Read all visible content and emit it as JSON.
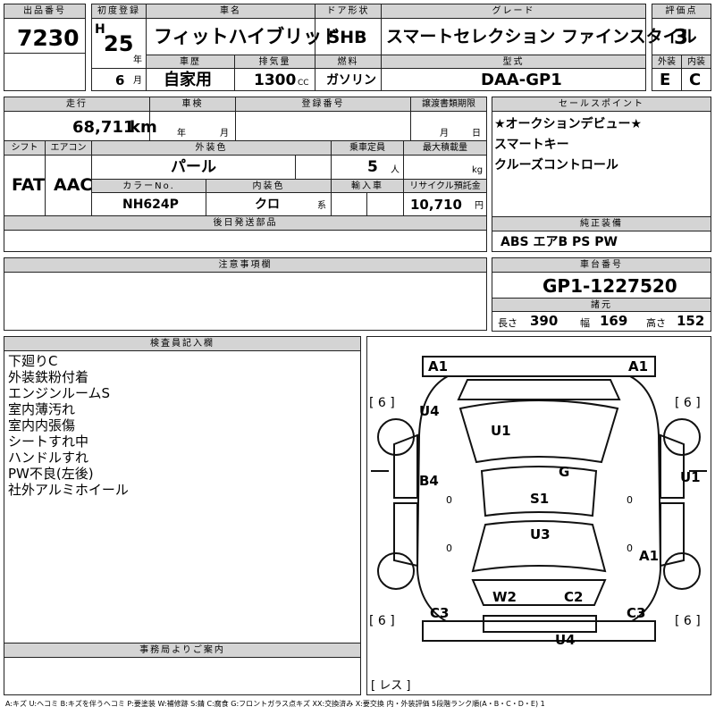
{
  "headers": {
    "lot_no": "出品番号",
    "first_reg": "初度登録",
    "car_name": "車名",
    "door": "ドア形状",
    "grade": "グレード",
    "rating": "評価点",
    "history": "車歴",
    "displacement": "排気量",
    "fuel": "燃料",
    "model_code": "型式",
    "exterior": "外装",
    "interior": "内装",
    "mileage": "走行",
    "inspection": "車検",
    "reg_no": "登録番号",
    "transfer_deadline": "譲渡書類期限",
    "sales_points": "セールスポイント",
    "shift": "シフト",
    "aircon": "エアコン",
    "ext_color": "外装色",
    "capacity": "乗車定員",
    "max_load": "最大積載量",
    "color_no": "カラーNo.",
    "int_color": "内装色",
    "import": "輸入車",
    "recycle": "リサイクル預託金",
    "later_parts": "後日発送部品",
    "genuine_equipment": "純正装備",
    "notes": "注意事項欄",
    "chassis_no": "車台番号",
    "dimensions": "諸元",
    "inspector": "検査員記入欄",
    "office": "事務局よりご案内"
  },
  "lot_no": "7230",
  "era": "H",
  "year": "25",
  "year_unit": "年",
  "month": "6",
  "month_unit": "月",
  "car_name": "フィットハイブリッド",
  "door": "5HB",
  "grade": "スマートセレクション ファインスタイル",
  "rating": "3",
  "history": "自家用",
  "displacement": "1300",
  "displacement_unit": "CC",
  "fuel": "ガソリン",
  "model_code": "DAA-GP1",
  "exterior_grade": "E",
  "interior_grade": "C",
  "mileage": "68,711",
  "mileage_unit": "km",
  "inspection_year_unit": "年",
  "inspection_month_unit": "月",
  "transfer_month_unit": "月",
  "transfer_day_unit": "日",
  "sales_points": [
    "★オークションデビュー★",
    "スマートキー",
    "クルーズコントロール"
  ],
  "shift": "FAT",
  "aircon": "AAC",
  "ext_color": "パール",
  "capacity": "5",
  "capacity_unit": "人",
  "max_load_unit": "kg",
  "color_no": "NH624P",
  "int_color": "クロ",
  "int_color_suffix": "系",
  "recycle": "10,710",
  "recycle_unit": "円",
  "genuine_equipment": "ABS エアB PS PW",
  "chassis_no": "GP1-1227520",
  "dims": {
    "length_label": "長さ",
    "length": "390",
    "width_label": "幅",
    "width": "169",
    "height_label": "高さ",
    "height": "152"
  },
  "inspector_notes": [
    "下廻りC",
    "外装鉄粉付着",
    "エンジンルームS",
    "室内薄汚れ",
    "室内内張傷",
    "シートすれ中",
    "ハンドルすれ",
    "PW不良(左後)",
    "社外アルミホイール"
  ],
  "diagram": {
    "tire_label": "[ 6 ]",
    "marks": [
      "A1",
      "A1",
      "U4",
      "U1",
      "G",
      "U1",
      "B4",
      "S1",
      "U3",
      "A1",
      "W2",
      "C2",
      "C3",
      "C3",
      "U4"
    ],
    "wheel_zero": "0",
    "spare": "[ レス ]"
  },
  "legend": "A:キズ U:ヘコミ B:キズを伴うヘコミ P:要塗装 W:補修跡 S:錆 C:腐食 G:フロントガラス点キズ XX:交換済み X:要交換 内・外装評価 5段階ランク順(A・B・C・D・E) 1"
}
